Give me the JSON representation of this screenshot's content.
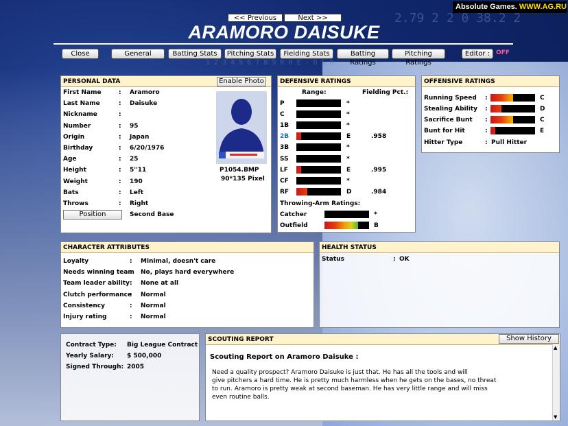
{
  "badge": {
    "prefix": "Absolute Games. ",
    "site": "WWW.AG.RU"
  },
  "nav": {
    "prev": "<< Previous",
    "next": "Next >>"
  },
  "player_name": "ARAMORO DAISUKE",
  "bg_numbers": {
    "top": "2.79 2 2 0 38.2 2",
    "row": "1 2 3 4 5 6 7 8 9 R H E - B S O"
  },
  "tabs": [
    "Close",
    "General",
    "Batting Stats",
    "Pitching Stats",
    "Fielding Stats",
    "Batting Ratings",
    "Pitching Ratings",
    "Editor :"
  ],
  "editor_state": "OFF",
  "personal": {
    "title": "PERSONAL DATA",
    "enable_photo": "Enable Photo",
    "fields": [
      [
        "First Name",
        "Aramoro"
      ],
      [
        "Last Name",
        "Daisuke"
      ],
      [
        "Nickname",
        ""
      ],
      [
        "Number",
        "95"
      ],
      [
        "Origin",
        "Japan"
      ],
      [
        "Birthday",
        "6/20/1976"
      ],
      [
        "Age",
        "25"
      ],
      [
        "Height",
        "5''11"
      ],
      [
        "Weight",
        "190"
      ],
      [
        "Bats",
        "Left"
      ],
      [
        "Throws",
        "Right"
      ]
    ],
    "position_btn": "Position",
    "position_value": "Second Base",
    "photo_file": "P1054.BMP",
    "photo_size": "90*135 Pixel"
  },
  "defensive": {
    "title": "DEFENSIVE RATINGS",
    "range_header": "Range:",
    "pct_header": "Fielding Pct.:",
    "positions": [
      {
        "pos": "P",
        "grade": "*",
        "pct": "",
        "fill": 0
      },
      {
        "pos": "C",
        "grade": "*",
        "pct": "",
        "fill": 0
      },
      {
        "pos": "1B",
        "grade": "*",
        "pct": "",
        "fill": 0
      },
      {
        "pos": "2B",
        "grade": "E",
        "pct": ".958",
        "fill": 0.1,
        "highlight": true
      },
      {
        "pos": "3B",
        "grade": "*",
        "pct": "",
        "fill": 0
      },
      {
        "pos": "SS",
        "grade": "*",
        "pct": "",
        "fill": 0
      },
      {
        "pos": "LF",
        "grade": "E",
        "pct": ".995",
        "fill": 0.1
      },
      {
        "pos": "CF",
        "grade": "*",
        "pct": "",
        "fill": 0
      },
      {
        "pos": "RF",
        "grade": "D",
        "pct": ".984",
        "fill": 0.25
      }
    ],
    "throwing_title": "Throwing-Arm Ratings:",
    "throwing": [
      {
        "pos": "Catcher",
        "grade": "*",
        "fill": 0
      },
      {
        "pos": "Outfield",
        "grade": "B",
        "fill": 0.75
      }
    ]
  },
  "offensive": {
    "title": "OFFENSIVE RATINGS",
    "ratings": [
      {
        "label": "Running Speed",
        "grade": "C",
        "fill": 0.5
      },
      {
        "label": "Stealing Ability",
        "grade": "D",
        "fill": 0.25
      },
      {
        "label": "Sacrifice Bunt",
        "grade": "C",
        "fill": 0.5
      },
      {
        "label": "Bunt for Hit",
        "grade": "E",
        "fill": 0.1
      }
    ],
    "hitter_label": "Hitter Type",
    "hitter_value": "Pull Hitter"
  },
  "character": {
    "title": "CHARACTER ATTRIBUTES",
    "attrs": [
      [
        "Loyalty",
        "Minimal, doesn't care"
      ],
      [
        "Needs winning team",
        "No, plays hard everywhere"
      ],
      [
        "Team leader ability",
        "None at all"
      ],
      [
        "Clutch performance",
        "Normal"
      ],
      [
        "Consistency",
        "Normal"
      ],
      [
        "Injury rating",
        "Normal"
      ]
    ]
  },
  "health": {
    "title": "HEALTH STATUS",
    "label": "Status",
    "value": "OK"
  },
  "contract": {
    "fields": [
      [
        "Contract Type:",
        "Big League Contract"
      ],
      [
        "Yearly Salary:",
        "$ 500,000"
      ],
      [
        "Signed Through:",
        "2005"
      ]
    ]
  },
  "scouting": {
    "title": "SCOUTING REPORT",
    "show_history": "Show History",
    "heading": "Scouting Report on Aramoro Daisuke :",
    "lines": [
      "Need a quality prospect? Aramoro Daisuke is just that. He has all the tools and will",
      "give pitchers a hard time. He is pretty much harmless when he gets on the bases, no threat",
      "to run. Aramoro is pretty weak at second baseman. He has very little range and will miss",
      "even routine balls."
    ]
  },
  "colors": {
    "header_bg": "#fff3cc",
    "highlight_pos": "#1a6ec8",
    "editor_off": "#ff5a9a"
  }
}
